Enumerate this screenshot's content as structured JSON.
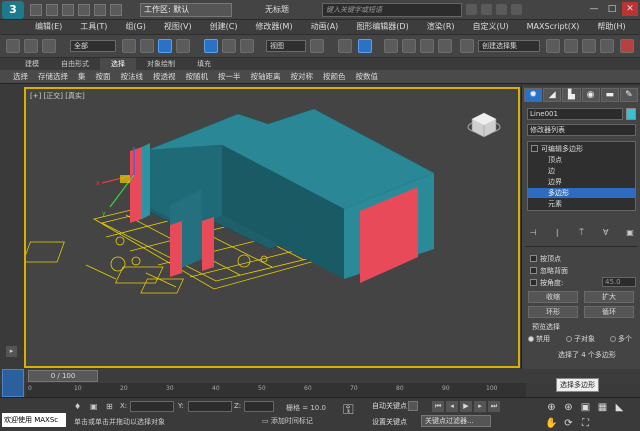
{
  "title_bar": {
    "logo": "3",
    "workspace": "工作区: 默认",
    "window_title": "无标题",
    "search_placeholder": "键入关键字或短语"
  },
  "menu": [
    "编辑(E)",
    "工具(T)",
    "组(G)",
    "视图(V)",
    "创建(C)",
    "修改器(M)",
    "动画(A)",
    "图形编辑器(D)",
    "渲染(R)",
    "自定义(U)",
    "MAXScript(X)",
    "帮助(H)"
  ],
  "toolbar": {
    "filter_value": "全部",
    "view_value": "视图",
    "selection_set": "创建选择集"
  },
  "ribbon": {
    "tabs": [
      "建模",
      "自由形式",
      "选择",
      "对象绘制",
      "填充"
    ],
    "active_tab": "选择",
    "tools": [
      "选择",
      "存储选择",
      "集",
      "按面",
      "按法线",
      "按透视",
      "按随机",
      "按一半",
      "按轴距离",
      "按对称",
      "按颜色",
      "按数值"
    ]
  },
  "viewport": {
    "label": "[+] [正交] [真实]"
  },
  "command_panel": {
    "tab_icons": [
      "✹",
      "◢",
      "▙",
      "◉",
      "▬",
      "✎"
    ],
    "object_name": "Line001",
    "object_color": "#3ac0d0",
    "modifier_list": "修改器列表",
    "stack": {
      "root": "可编辑多边形",
      "items": [
        "顶点",
        "边",
        "边界",
        "多边形",
        "元素"
      ],
      "selected": "多边形"
    },
    "stack_tools": [
      "⊣",
      "|",
      "⍑",
      "∀",
      "▣"
    ],
    "options": {
      "by_vertex": "按顶点",
      "ignore_backface": "忽略背面",
      "by_angle": "按角度:",
      "angle_value": "45.0",
      "shrink": "收缩",
      "grow": "扩大",
      "ring": "环形",
      "loop": "循环"
    },
    "preview": {
      "title": "预览选择",
      "disabled": "禁用",
      "sub_object": "子对象",
      "multi": "多个",
      "status": "选择了 4 个多边形"
    }
  },
  "timeline": {
    "slider": "0 / 100",
    "ticks": [
      "0",
      "10",
      "20",
      "30",
      "40",
      "50",
      "60",
      "70",
      "80",
      "90",
      "100"
    ]
  },
  "status": {
    "maxscript": "欢迎使用 MAXSc",
    "message": "单击或单击并拖动以选择对象",
    "add_time_tag": "添加时间标记",
    "x_label": "X:",
    "y_label": "Y:",
    "z_label": "Z:",
    "grid": "栅格 = 10.0",
    "auto_key": "自动关键点",
    "set_key": "设置关键点",
    "key_filter": "关键点过滤器...",
    "tooltip": "选择多边形"
  }
}
